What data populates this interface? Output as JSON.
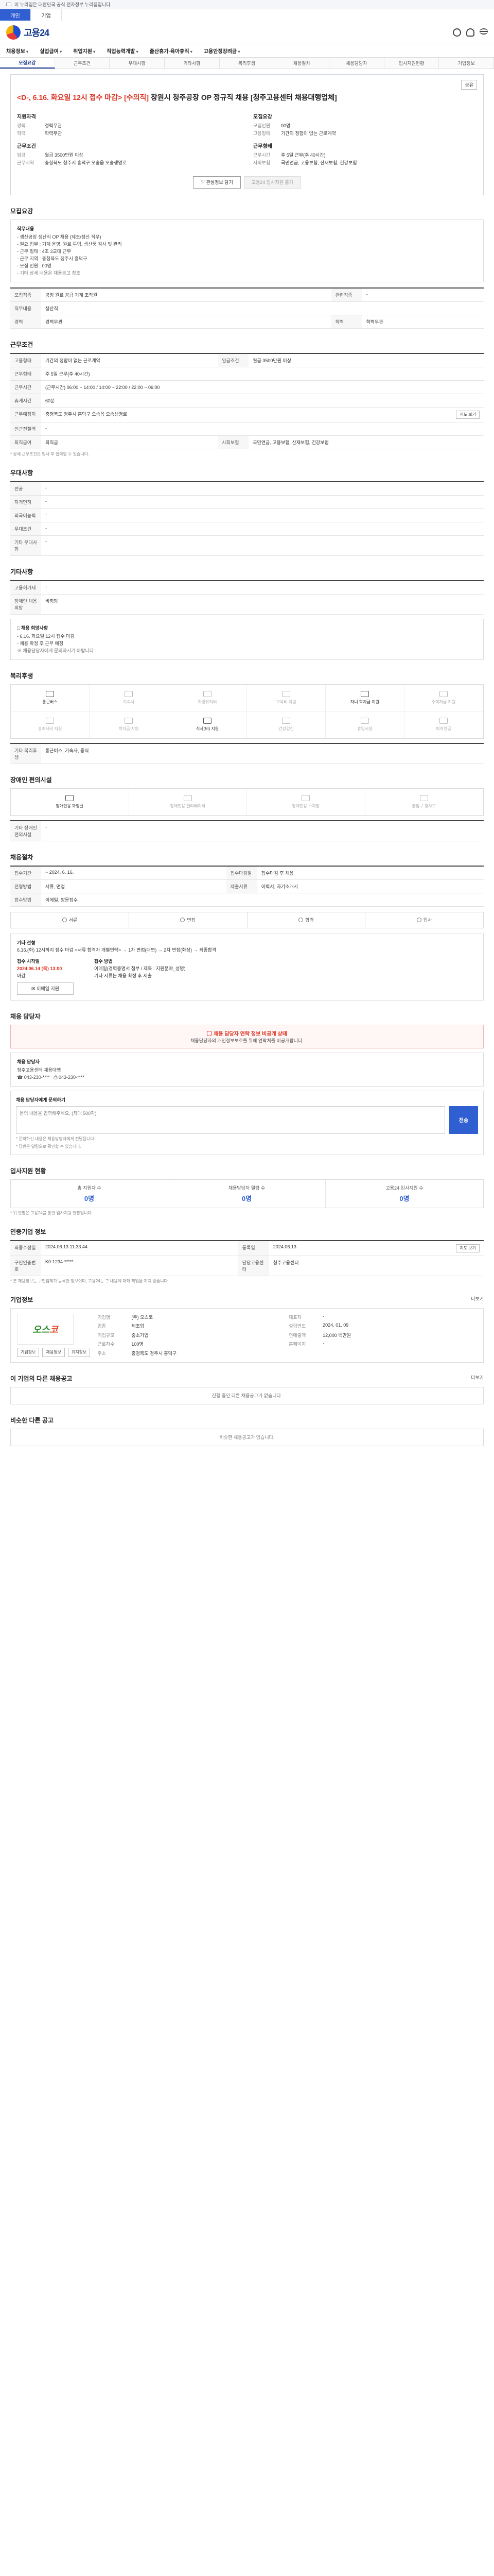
{
  "gov_bar": {
    "text": "이 누리집은 대한민국 공식 전자정부 누리집입니다."
  },
  "top_tabs": [
    "개인",
    "기업"
  ],
  "brand": {
    "name": "고용24"
  },
  "gnb": [
    "채용정보",
    "실업급여",
    "취업지원",
    "직업능력개발",
    "출산휴가·육아휴직",
    "고용안정장려금"
  ],
  "sub_tabs": [
    "모집요강",
    "근무조건",
    "우대사항",
    "기타사항",
    "복리후생",
    "채용절차",
    "채용담당자",
    "입사지원현황",
    "기업정보"
  ],
  "header_action": "공유",
  "title": {
    "prefix": "<D-, 6.16. 화요일 12시 접수 마감> [수의직]",
    "rest": " 창원시 청주공장 OP 정규직 채용 [청주고용센터 채용대행업체]"
  },
  "summary": {
    "left_head": "지원자격",
    "left": [
      [
        "경력",
        "경력무관"
      ],
      [
        "학력",
        "학력무관"
      ]
    ],
    "right_head": "모집요강",
    "right": [
      [
        "모집인원",
        "00명"
      ],
      [
        "고용형태",
        "기간의 정함이 없는 근로계약"
      ]
    ],
    "left2_head": "근무조건",
    "left2": [
      [
        "임금",
        "월급 3500만원 이상"
      ],
      [
        "근무지역",
        "충청북도 청주시 흥덕구 오송읍 오송생명로"
      ]
    ],
    "right2_head": "근무형태",
    "right2": [
      [
        "근무시간",
        "주 5일 근무(주 40시간)"
      ],
      [
        "사회보험",
        "국민연금, 고용보험, 산재보험, 건강보험"
      ]
    ]
  },
  "actions": {
    "scrap": "관심정보 담기",
    "apply": "고용24 입사지원 불가"
  },
  "recruit": {
    "section": "모집요강",
    "box_head": "직무내용",
    "box_lines": [
      "- 생산공장 생산직 OP 채용 (제조/생산 직무)",
      "- 필요 업무 : 기계 운영, 원료 투입, 생산품 검사 및 관리",
      "- 근무 형태 : 4조 3교대 근무",
      "- 근무 지역 : 충청북도 청주시 흥덕구",
      "- 모집 인원 : 00명"
    ],
    "box_note": "- 기타 상세 내용은 채용공고 참조",
    "rows": [
      [
        "모집직종",
        "공정 원료 공급 기계 조작원"
      ],
      [
        "관련직종",
        "-"
      ],
      [
        "직무내용",
        "생산직"
      ],
      [
        "경력",
        "경력무관"
      ],
      [
        "학력",
        "학력무관"
      ]
    ]
  },
  "conditions": {
    "section": "근무조건",
    "rows": [
      [
        "고용형태",
        "기간의 정함이 없는 근로계약"
      ],
      [
        "임금조건",
        "월급 3500만원 이상"
      ],
      [
        "근무형태",
        "주 5일 근무(주 40시간)"
      ],
      [
        "근무시간",
        "(근무시간) 06:00 ~ 14:00 / 14:00 ~ 22:00 / 22:00 ~ 06:00"
      ],
      [
        "휴게시간",
        "60분"
      ],
      [
        "근무예정지",
        "충청북도 청주시 흥덕구 오송읍 오송생명로"
      ],
      [
        "인근전철역",
        "-"
      ],
      [
        "퇴직급여",
        "퇴직금"
      ],
      [
        "사회보험",
        "국민연금, 고용보험, 산재보험, 건강보험"
      ]
    ],
    "map_btn": "지도 보기",
    "note": "* 상세 근무조건은 입사 후 협의할 수 있습니다."
  },
  "preference": {
    "section": "우대사항",
    "rows": [
      [
        "전공",
        "-"
      ],
      [
        "자격면허",
        "-"
      ],
      [
        "외국어능력",
        "-"
      ],
      [
        "우대조건",
        "-"
      ],
      [
        "기타 우대사항",
        "-"
      ]
    ]
  },
  "etc": {
    "section": "기타사항",
    "rows": [
      [
        "고용허가제",
        "-"
      ],
      [
        "장애인 채용희망",
        "비희망"
      ]
    ],
    "box_head": "□ 채용 희망사항",
    "box_lines": [
      "- 6.16. 화요일 12시 접수 마감",
      "- 채용 확정 후 근무 예정"
    ],
    "box_note": "※ 채용담당자에게 문의하시기 바랍니다."
  },
  "welfare": {
    "section": "복리후생",
    "items": [
      "통근버스",
      "기숙사",
      "차량유지비",
      "교육비 지원",
      "자녀 학자금 지원",
      "주택자금 지원",
      "경조사비 지원",
      "학자금 지원",
      "식사(비) 지원",
      "건강검진",
      "휴양시설",
      "퇴직연금"
    ],
    "active": [
      0,
      4,
      8
    ],
    "etc_label": "기타 복리후생",
    "etc_value": "통근버스, 기숙사, 중식"
  },
  "disabled": {
    "section": "장애인 편의시설",
    "items": [
      "장애인용 화장실",
      "장애인용 엘리베이터",
      "장애인용 주차장",
      "출입구 경사로"
    ],
    "etc_label": "기타 장애인 편의시설",
    "etc_value": "-"
  },
  "procedure": {
    "section": "채용절차",
    "rows": [
      [
        "접수기간",
        "~ 2024. 6. 16."
      ],
      [
        "접수마감일",
        "접수마감 후 채용"
      ],
      [
        "전형방법",
        "서류, 면접"
      ],
      [
        "제출서류",
        "이력서, 자기소개서"
      ],
      [
        "접수방법",
        "이메일, 방문접수"
      ]
    ],
    "steps": [
      "서류",
      "면접",
      "합격",
      "입사"
    ],
    "flow_head": "기타 전형",
    "flow_text": "6.16.(화) 12시까지 접수 마감 <서류 합격자 개별연락> → 1차 면접(대면) → 2차 면접(화상) → 최종합격",
    "apply_head": "접수 시작일",
    "apply_date": "2024.06.14 (목) 13:00",
    "apply_sub": "마감",
    "apply_btn": "이메일 지원",
    "req_head": "접수 방법",
    "req_lines": [
      "이메일(경력증명서 첨부 / 제목 : 지원분야_성명)",
      "기타 서류는 채용 확정 후 제출"
    ]
  },
  "manager": {
    "section": "채용 담당자",
    "warn": "채용 담당자 연락 정보 비공개 상태",
    "banner_line": "채용담당자의 개인정보보호를 위해 연락처를 비공개합니다.",
    "info_head": "채용 담당자",
    "info_org": "청주고용센터 채용대행",
    "info_phone": "043-230-****",
    "info_fax": "043-230-****",
    "inquiry_head": "채용 담당자에게 문의하기",
    "inquiry_placeholder": "문의 내용을 입력해주세요. (최대 500자)",
    "send": "전송",
    "notes": [
      "* 문의하신 내용은 채용담당자에게 전달됩니다.",
      "* 답변은 알림으로 확인할 수 있습니다."
    ]
  },
  "status": {
    "section": "입사지원 현황",
    "cells": [
      [
        "총 지원자 수",
        "0명"
      ],
      [
        "채용담당자 열람 수",
        "0명"
      ],
      [
        "고용24 입사지원 수",
        "0명"
      ]
    ],
    "note": "* 위 현황은 고용24를 통한 입사지원 현황입니다."
  },
  "registration": {
    "section": "인증기업 정보",
    "rows": [
      [
        "최종수정일",
        "2024.06.13 11:33:44",
        "등록일",
        "2024.06.13"
      ],
      [
        "구인인증번호",
        "K0-1234-*****",
        "담당고용센터",
        "청주고용센터"
      ]
    ],
    "btn": "지도 보기",
    "note": "* 본 채용정보는 구인업체가 등록한 정보이며, 고용24는 그 내용에 대해 책임을 지지 않습니다."
  },
  "company": {
    "section": "기업정보",
    "logo_a": "오스",
    "logo_b": "코",
    "rows": [
      [
        "기업명",
        "(주) 오스코",
        "대표자",
        "-"
      ],
      [
        "업종",
        "제조업",
        "설립연도",
        "2024. 01. 09"
      ],
      [
        "기업규모",
        "중소기업",
        "연매출액",
        "12,000 백만원"
      ],
      [
        "근로자수",
        "100명",
        "홈페이지",
        "-"
      ],
      [
        "주소",
        "충청북도 청주시 흥덕구",
        "",
        ""
      ]
    ],
    "links": [
      "기업정보",
      "채용정보",
      "위치정보"
    ],
    "more": "더보기"
  },
  "related": {
    "section": "이 기업의 다른 채용공고",
    "empty": "진행 중인 다른 채용공고가 없습니다.",
    "more": "더보기"
  },
  "similar": {
    "section": "비슷한 다른 공고",
    "empty": "비슷한 채용공고가 없습니다."
  }
}
